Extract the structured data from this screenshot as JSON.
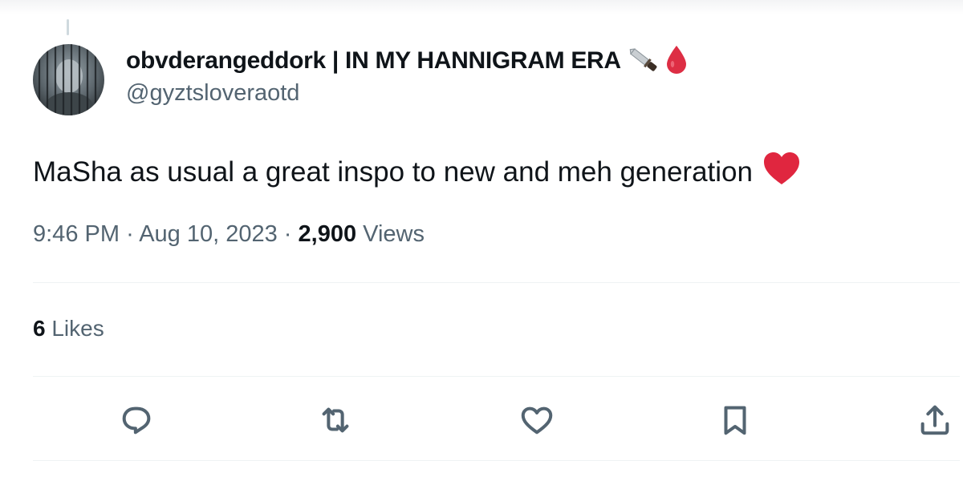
{
  "tweet": {
    "author": {
      "display_name": "obvderangeddork | IN MY HANNIGRAM ERA",
      "handle": "@gyztsloveraotd",
      "name_emojis": [
        "knife-icon",
        "blood-drop-icon"
      ]
    },
    "text": "MaSha as usual a great inspo to new and meh generation",
    "text_emoji": "red-heart-icon",
    "meta": {
      "time": "9:46 PM",
      "separator": "·",
      "date": "Aug 10, 2023",
      "views_count": "2,900",
      "views_label": "Views"
    },
    "likes": {
      "count": "6",
      "label": "Likes"
    },
    "actions": [
      {
        "name": "reply",
        "icon": "reply-icon"
      },
      {
        "name": "retweet",
        "icon": "retweet-icon"
      },
      {
        "name": "like",
        "icon": "heart-icon"
      },
      {
        "name": "bookmark",
        "icon": "bookmark-icon"
      },
      {
        "name": "share",
        "icon": "share-icon"
      }
    ]
  },
  "colors": {
    "text_primary": "#0f1419",
    "text_secondary": "#536471",
    "divider": "#eff3f4",
    "heart_red": "#e0263f"
  }
}
